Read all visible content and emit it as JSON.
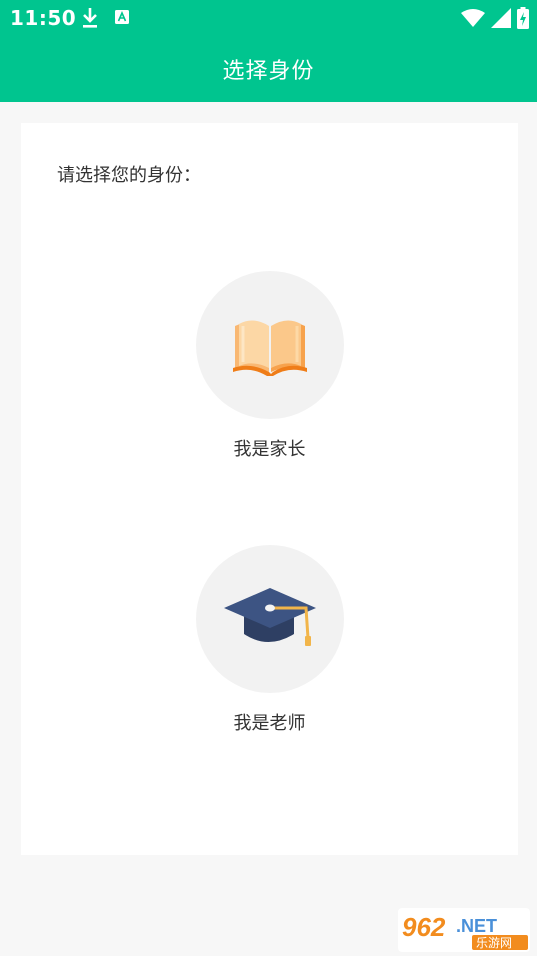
{
  "status_bar": {
    "time": "11:50",
    "icons": [
      "download-icon",
      "a-icon",
      "wifi-icon",
      "signal-icon",
      "battery-icon"
    ]
  },
  "app_bar": {
    "title": "选择身份"
  },
  "main": {
    "prompt": "请选择您的身份：",
    "roles": [
      {
        "icon": "book-icon",
        "label": "我是家长"
      },
      {
        "icon": "graduation-cap-icon",
        "label": "我是老师"
      }
    ]
  },
  "watermark": {
    "brand": "962.NET",
    "subtitle": "乐游网"
  },
  "colors": {
    "primary": "#00c58f",
    "background": "#f7f7f7",
    "card": "#ffffff",
    "icon_circle": "#f2f2f2",
    "text": "#333333"
  }
}
